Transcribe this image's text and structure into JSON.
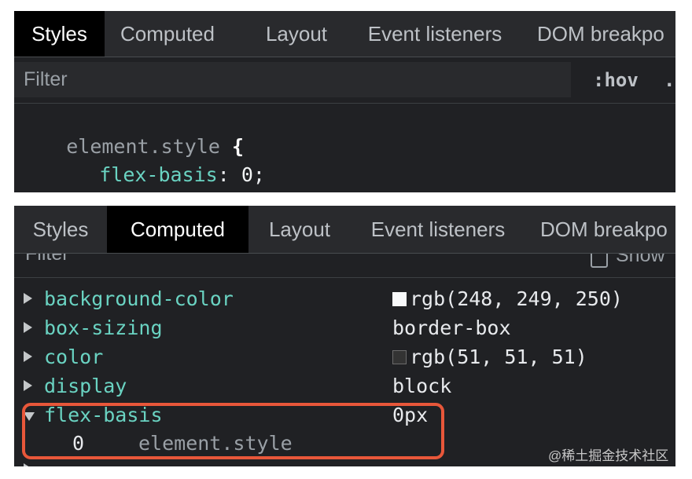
{
  "top_panel": {
    "tabs": [
      "Styles",
      "Computed",
      "Layout",
      "Event listeners",
      "DOM breakpo"
    ],
    "filter": {
      "placeholder": "Filter",
      "hov": ":hov",
      "cls": "."
    },
    "rule": {
      "selector": "element.style",
      "open_brace": "{",
      "property": "flex-basis",
      "colon": ":",
      "value": "0",
      "semicolon": ";",
      "close_brace": "}"
    }
  },
  "bottom_panel": {
    "tabs": [
      "Styles",
      "Computed",
      "Layout",
      "Event listeners",
      "DOM breakpo"
    ],
    "filter_label": "Filter",
    "show_all_label": "Show",
    "properties": [
      {
        "name": "background-color",
        "value": "rgb(248, 249, 250)",
        "swatch": "#f8f9fa",
        "expanded": false
      },
      {
        "name": "box-sizing",
        "value": "border-box",
        "expanded": false
      },
      {
        "name": "color",
        "value": "rgb(51, 51, 51)",
        "swatch": "#333333",
        "expanded": false
      },
      {
        "name": "display",
        "value": "block",
        "expanded": false
      },
      {
        "name": "flex-basis",
        "value": "0px",
        "expanded": true
      }
    ],
    "trace": {
      "value": "0",
      "source": "element.style"
    }
  },
  "colors": {
    "highlight": "#e8573a",
    "property_name": "#6ad3c2",
    "active_tab": "#000000"
  },
  "watermark": "@稀土掘金技术社区"
}
